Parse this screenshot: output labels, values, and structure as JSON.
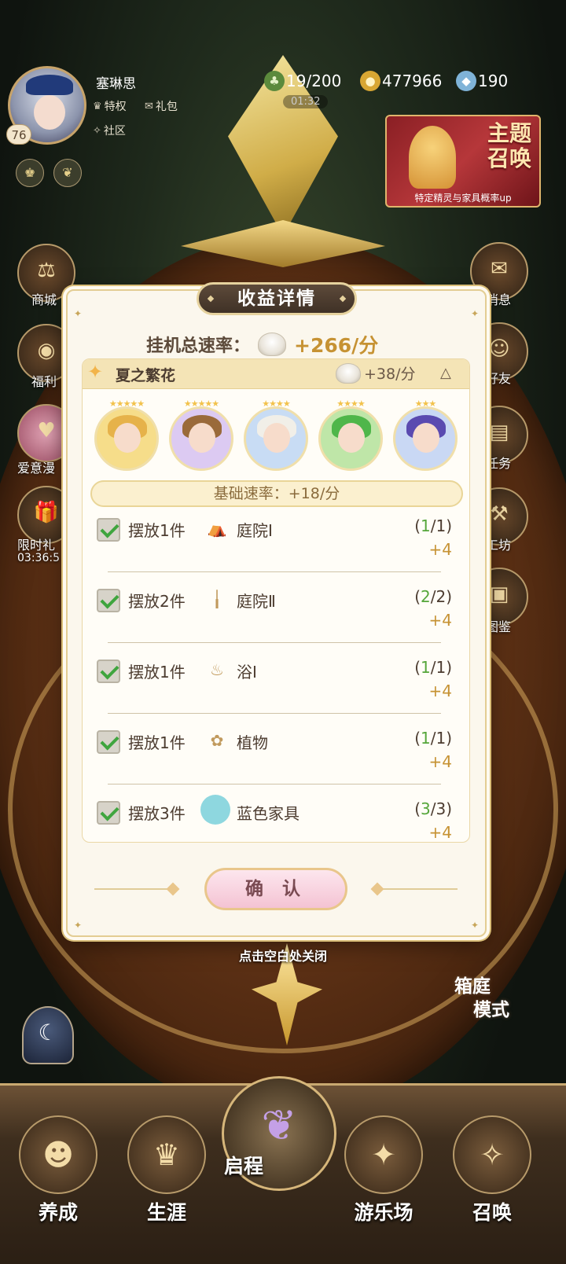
{
  "player": {
    "name": "塞琳思",
    "level": "76",
    "links": {
      "privilege": "特权",
      "gift": "礼包",
      "community": "社区"
    }
  },
  "resources": {
    "energy": "19/200",
    "energy_timer": "01:32",
    "coins": "477966",
    "gems": "190"
  },
  "banner": {
    "title_line1": "主题",
    "title_line2": "召唤",
    "subtitle": "特定精灵与家具概率up"
  },
  "left_menu": {
    "shop": "商城",
    "welfare": "福利",
    "love_comic": "爱意漫",
    "limited_gift": "限时礼",
    "limited_timer": "03:36:5"
  },
  "right_menu": {
    "messages": "消息",
    "friends": "好友",
    "tasks": "任务",
    "workshop": "工坊",
    "catalog": "图鉴"
  },
  "modal": {
    "title": "收益详情",
    "total_rate_label": "挂机总速率：",
    "total_rate_value": "+266/分",
    "set": {
      "name": "夏之繁花",
      "rate": "+38/分",
      "characters": [
        {
          "stars": "★★★★★",
          "hair_color": "#e6b24a",
          "bg_color": "#f6dd8a"
        },
        {
          "stars": "★★★★★",
          "hair_color": "#9a6a3a",
          "bg_color": "#dccaf2"
        },
        {
          "stars": "★★★★",
          "hair_color": "#f1efe8",
          "bg_color": "#c8dcf4"
        },
        {
          "stars": "★★★★",
          "hair_color": "#4fb64a",
          "bg_color": "#bfe6a8"
        },
        {
          "stars": "★★★",
          "hair_color": "#5a4ab0",
          "bg_color": "#c9d8f4"
        }
      ],
      "base_rate": "基础速率：+18/分",
      "tasks": [
        {
          "label": "摆放1件",
          "icon": "tent-icon",
          "glyph": "⛺",
          "category": "庭院Ⅰ",
          "done": "1",
          "total": "/1)",
          "open": "(",
          "bonus": "+4"
        },
        {
          "label": "摆放2件",
          "icon": "lamp-post-icon",
          "glyph": "╽",
          "category": "庭院Ⅱ",
          "done": "2",
          "total": "/2)",
          "open": "(",
          "bonus": "+4"
        },
        {
          "label": "摆放1件",
          "icon": "bathtub-icon",
          "glyph": "♨",
          "category": "浴Ⅰ",
          "done": "1",
          "total": "/1)",
          "open": "(",
          "bonus": "+4"
        },
        {
          "label": "摆放1件",
          "icon": "plant-icon",
          "glyph": "✿",
          "category": "植物",
          "done": "1",
          "total": "/1)",
          "open": "(",
          "bonus": "+4"
        },
        {
          "label": "摆放3件",
          "icon": "blue-color-dot-icon",
          "glyph": "",
          "category": "蓝色家具",
          "done": "3",
          "total": "/3)",
          "open": "(",
          "bonus": "+4"
        }
      ]
    },
    "confirm": "确 认"
  },
  "close_hint": "点击空白处关闭",
  "box_mode": {
    "line1": "箱庭",
    "line2": "模式"
  },
  "nav": {
    "develop": "养成",
    "career": "生涯",
    "journey": "启程",
    "playground": "游乐场",
    "summon": "召唤"
  },
  "colors": {
    "accent_gold": "#c69233",
    "progress_green": "#55a63a",
    "modal_bg": "#fbf7ed",
    "confirm_pink": "#f4c3d3"
  }
}
